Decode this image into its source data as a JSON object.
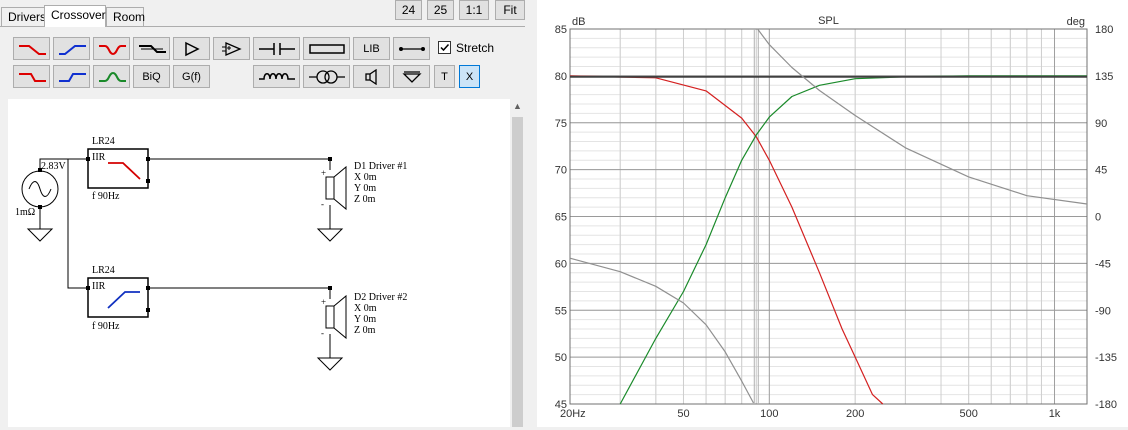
{
  "tabs": [
    {
      "label": "Drivers",
      "active": false
    },
    {
      "label": "Crossover",
      "active": true
    },
    {
      "label": "Room",
      "active": false
    }
  ],
  "zoom_buttons": [
    "24",
    "25",
    "1:1",
    "Fit"
  ],
  "toolbar": {
    "lib_label": "LIB",
    "biq_label": "BiQ",
    "gf_label": "G(f)",
    "t_label": "T",
    "x_label": "X",
    "stretch_label": "Stretch",
    "stretch_checked": true
  },
  "schematic": {
    "source": {
      "voltage": "2.83V",
      "impedance": "1mΩ"
    },
    "filters": [
      {
        "name": "LR24",
        "type": "IIR",
        "freq": "f  90Hz",
        "kind": "lowpass",
        "color": "#d40000"
      },
      {
        "name": "LR24",
        "type": "IIR",
        "freq": "f  90Hz",
        "kind": "highpass",
        "color": "#1030c0"
      }
    ],
    "drivers": [
      {
        "name": "D1 Driver #1",
        "x": "X 0m",
        "y": "Y 0m",
        "z": "Z 0m"
      },
      {
        "name": "D2 Driver #2",
        "x": "X 0m",
        "y": "Y 0m",
        "z": "Z 0m"
      }
    ]
  },
  "chart_data": {
    "type": "line",
    "title": "SPL",
    "ylabel": "dB",
    "y2label": "deg",
    "xscale": "log",
    "xlim": [
      20,
      1300
    ],
    "ylim": [
      45,
      85
    ],
    "y2lim": [
      -180,
      180
    ],
    "xticks": [
      {
        "v": 20,
        "l": "20Hz"
      },
      {
        "v": 50,
        "l": "50"
      },
      {
        "v": 100,
        "l": "100"
      },
      {
        "v": 200,
        "l": "200"
      },
      {
        "v": 500,
        "l": "500"
      },
      {
        "v": 1000,
        "l": "1k"
      }
    ],
    "yticks": [
      85,
      80,
      75,
      70,
      65,
      60,
      55,
      50,
      45
    ],
    "y2ticks": [
      180,
      135,
      90,
      45,
      0,
      -45,
      -90,
      -135,
      -180
    ],
    "grid": true,
    "cursor_x": 90,
    "series": [
      {
        "color": "#d42020",
        "axis": "left",
        "x": [
          20,
          40,
          60,
          80,
          90,
          100,
          120,
          150,
          180,
          200,
          230,
          250
        ],
        "y": [
          80,
          79.8,
          78.4,
          75.5,
          73.5,
          71,
          66,
          59,
          53,
          50,
          46,
          44
        ]
      },
      {
        "color": "#1a8a2a",
        "axis": "left",
        "x": [
          30,
          40,
          50,
          60,
          70,
          80,
          90,
          100,
          120,
          150,
          200,
          300,
          500,
          1300
        ],
        "y": [
          45,
          52,
          57,
          62,
          67,
          71,
          73.7,
          75.6,
          77.8,
          79,
          79.7,
          79.9,
          80,
          80
        ]
      },
      {
        "color": "#404040",
        "axis": "left",
        "x": [
          20,
          1300
        ],
        "y": [
          79.9,
          79.9
        ]
      },
      {
        "color": "#909090",
        "axis": "right",
        "x": [
          20,
          30,
          40,
          50,
          60,
          70,
          80,
          88
        ],
        "y": [
          -40,
          -53,
          -67,
          -83,
          -104,
          -130,
          -158,
          -179
        ]
      },
      {
        "color": "#909090",
        "axis": "right",
        "x": [
          91,
          100,
          120,
          150,
          200,
          300,
          500,
          800,
          1300
        ],
        "y": [
          180,
          165,
          143,
          121,
          97,
          66,
          38,
          20,
          12
        ]
      }
    ]
  }
}
